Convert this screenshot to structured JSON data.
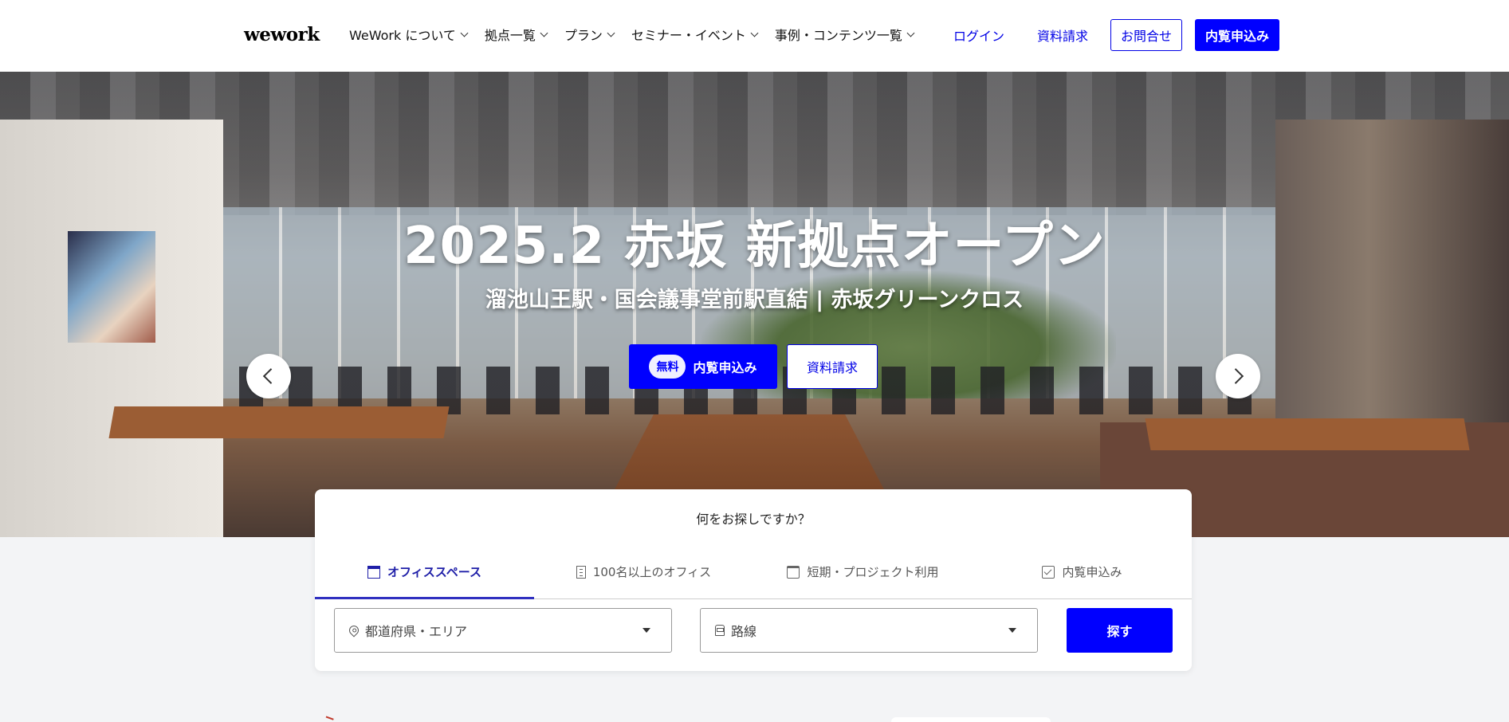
{
  "header": {
    "logo": "wework",
    "nav": [
      {
        "label": "WeWork について"
      },
      {
        "label": "拠点一覧"
      },
      {
        "label": "プラン"
      },
      {
        "label": "セミナー・イベント"
      },
      {
        "label": "事例・コンテンツ一覧"
      }
    ],
    "login": "ログイン",
    "brochure": "資料請求",
    "contact": "お問合せ",
    "tour": "内覧申込み"
  },
  "hero": {
    "title": "2025.2 赤坂 新拠点オープン",
    "subtitle": "溜池山王駅・国会議事堂前駅直結 | 赤坂グリーンクロス",
    "primary_badge": "無料",
    "primary_label": "内覧申込み",
    "secondary_label": "資料請求",
    "prev_icon": "chevron-left-icon",
    "next_icon": "chevron-right-icon"
  },
  "search": {
    "question": "何をお探しですか？",
    "tabs": [
      {
        "label": "オフィススペース",
        "icon": "storefront-icon",
        "active": true
      },
      {
        "label": "100名以上のオフィス",
        "icon": "building-icon",
        "active": false
      },
      {
        "label": "短期・プロジェクト利用",
        "icon": "calendar-icon",
        "active": false
      },
      {
        "label": "内覧申込み",
        "icon": "calendar-check-icon",
        "active": false
      }
    ],
    "area_placeholder": "都道府県・エリア",
    "line_placeholder": "路線",
    "button": "探す"
  },
  "colors": {
    "brand_blue": "#0000ff",
    "link_blue": "#0000e6",
    "active_tab": "#1f1fa8"
  }
}
